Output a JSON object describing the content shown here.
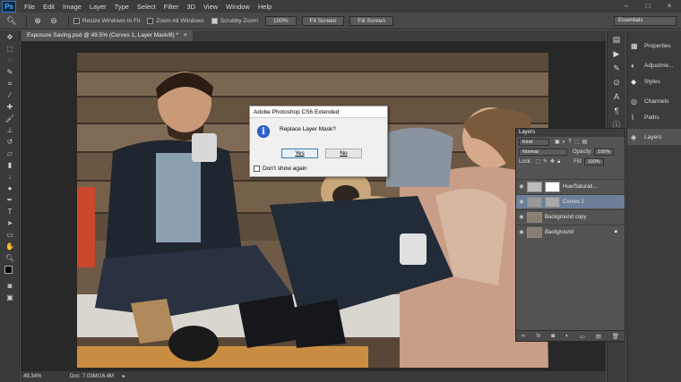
{
  "app": {
    "logo": "Ps"
  },
  "menu": [
    "File",
    "Edit",
    "Image",
    "Layer",
    "Type",
    "Select",
    "Filter",
    "3D",
    "View",
    "Window",
    "Help"
  ],
  "window_controls": {
    "minimize": "–",
    "maximize": "□",
    "close": "×"
  },
  "options": {
    "resize_windows": "Resize Windows to Fit",
    "zoom_all": "Zoom All Windows",
    "scrubby_zoom": "Scrubby Zoom",
    "btn_100": "100%",
    "fit_screen": "Fit Screen",
    "fill_screen": "Fill Screen",
    "workspace": "Essentials"
  },
  "doc_tab": {
    "title": "Exposure Saving.psd @ 49.5% (Curves 1, Layer Mask/8) *",
    "close": "×"
  },
  "status": {
    "zoom": "49.34%",
    "doc": "Doc: 7.03M/16.4M"
  },
  "right_dock": [
    {
      "label": "Properties",
      "icon": "properties-icon"
    },
    {
      "label": "Adjustme...",
      "icon": "adjustments-icon"
    },
    {
      "label": "Styles",
      "icon": "styles-icon"
    },
    {
      "label": "Channels",
      "icon": "channels-icon"
    },
    {
      "label": "Paths",
      "icon": "paths-icon"
    },
    {
      "label": "Layers",
      "icon": "layers-icon"
    }
  ],
  "layers_panel": {
    "title": "Layers",
    "kind": "Kind",
    "blend": "Normal",
    "opacity_label": "Opacity:",
    "opacity": "100%",
    "lock_label": "Lock:",
    "fill_label": "Fill:",
    "fill": "100%",
    "layers": [
      {
        "name": "Hue/Saturati...",
        "selected": false
      },
      {
        "name": "Curves 1",
        "selected": true
      },
      {
        "name": "Background copy",
        "selected": false
      },
      {
        "name": "Background",
        "selected": false
      }
    ]
  },
  "dialog": {
    "title": "Adobe Photoshop CS6 Extended",
    "message": "Replace Layer Mask?",
    "yes": "Yes",
    "no": "No",
    "dont_show": "Don't show again"
  }
}
